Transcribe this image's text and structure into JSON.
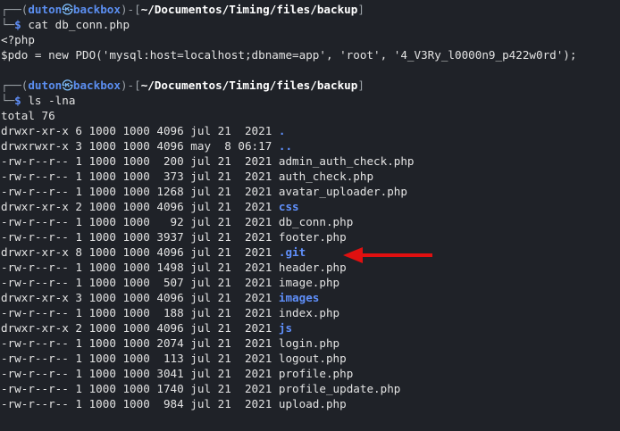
{
  "prompt1": {
    "user": "duton",
    "at_symbol": "㉿",
    "host": "backbox",
    "path": "~/Documentos/Timing/files/backup",
    "command": "cat db_conn.php"
  },
  "file_output": {
    "line1": "<?php",
    "line2": "$pdo = new PDO('mysql:host=localhost;dbname=app', 'root', '4_V3Ry_l0000n9_p422w0rd');"
  },
  "prompt2": {
    "user": "duton",
    "at_symbol": "㉿",
    "host": "backbox",
    "path": "~/Documentos/Timing/files/backup",
    "command": "ls -lna"
  },
  "ls": {
    "total": "total 76",
    "rows": [
      {
        "meta": "drwxr-xr-x 6 1000 1000 4096 jul 21  2021 ",
        "name": ".",
        "is_dir": true
      },
      {
        "meta": "drwxrwxr-x 3 1000 1000 4096 may  8 06:17 ",
        "name": "..",
        "is_dir": true
      },
      {
        "meta": "-rw-r--r-- 1 1000 1000  200 jul 21  2021 ",
        "name": "admin_auth_check.php",
        "is_dir": false
      },
      {
        "meta": "-rw-r--r-- 1 1000 1000  373 jul 21  2021 ",
        "name": "auth_check.php",
        "is_dir": false
      },
      {
        "meta": "-rw-r--r-- 1 1000 1000 1268 jul 21  2021 ",
        "name": "avatar_uploader.php",
        "is_dir": false
      },
      {
        "meta": "drwxr-xr-x 2 1000 1000 4096 jul 21  2021 ",
        "name": "css",
        "is_dir": true
      },
      {
        "meta": "-rw-r--r-- 1 1000 1000   92 jul 21  2021 ",
        "name": "db_conn.php",
        "is_dir": false
      },
      {
        "meta": "-rw-r--r-- 1 1000 1000 3937 jul 21  2021 ",
        "name": "footer.php",
        "is_dir": false
      },
      {
        "meta": "drwxr-xr-x 8 1000 1000 4096 jul 21  2021 ",
        "name": ".git",
        "is_dir": true
      },
      {
        "meta": "-rw-r--r-- 1 1000 1000 1498 jul 21  2021 ",
        "name": "header.php",
        "is_dir": false
      },
      {
        "meta": "-rw-r--r-- 1 1000 1000  507 jul 21  2021 ",
        "name": "image.php",
        "is_dir": false
      },
      {
        "meta": "drwxr-xr-x 3 1000 1000 4096 jul 21  2021 ",
        "name": "images",
        "is_dir": true
      },
      {
        "meta": "-rw-r--r-- 1 1000 1000  188 jul 21  2021 ",
        "name": "index.php",
        "is_dir": false
      },
      {
        "meta": "drwxr-xr-x 2 1000 1000 4096 jul 21  2021 ",
        "name": "js",
        "is_dir": true
      },
      {
        "meta": "-rw-r--r-- 1 1000 1000 2074 jul 21  2021 ",
        "name": "login.php",
        "is_dir": false
      },
      {
        "meta": "-rw-r--r-- 1 1000 1000  113 jul 21  2021 ",
        "name": "logout.php",
        "is_dir": false
      },
      {
        "meta": "-rw-r--r-- 1 1000 1000 3041 jul 21  2021 ",
        "name": "profile.php",
        "is_dir": false
      },
      {
        "meta": "-rw-r--r-- 1 1000 1000 1740 jul 21  2021 ",
        "name": "profile_update.php",
        "is_dir": false
      },
      {
        "meta": "-rw-r--r-- 1 1000 1000  984 jul 21  2021 ",
        "name": "upload.php",
        "is_dir": false
      }
    ]
  },
  "colors": {
    "background": "#1f2228",
    "directory": "#5f8ffa",
    "arrow": "#e01010"
  }
}
